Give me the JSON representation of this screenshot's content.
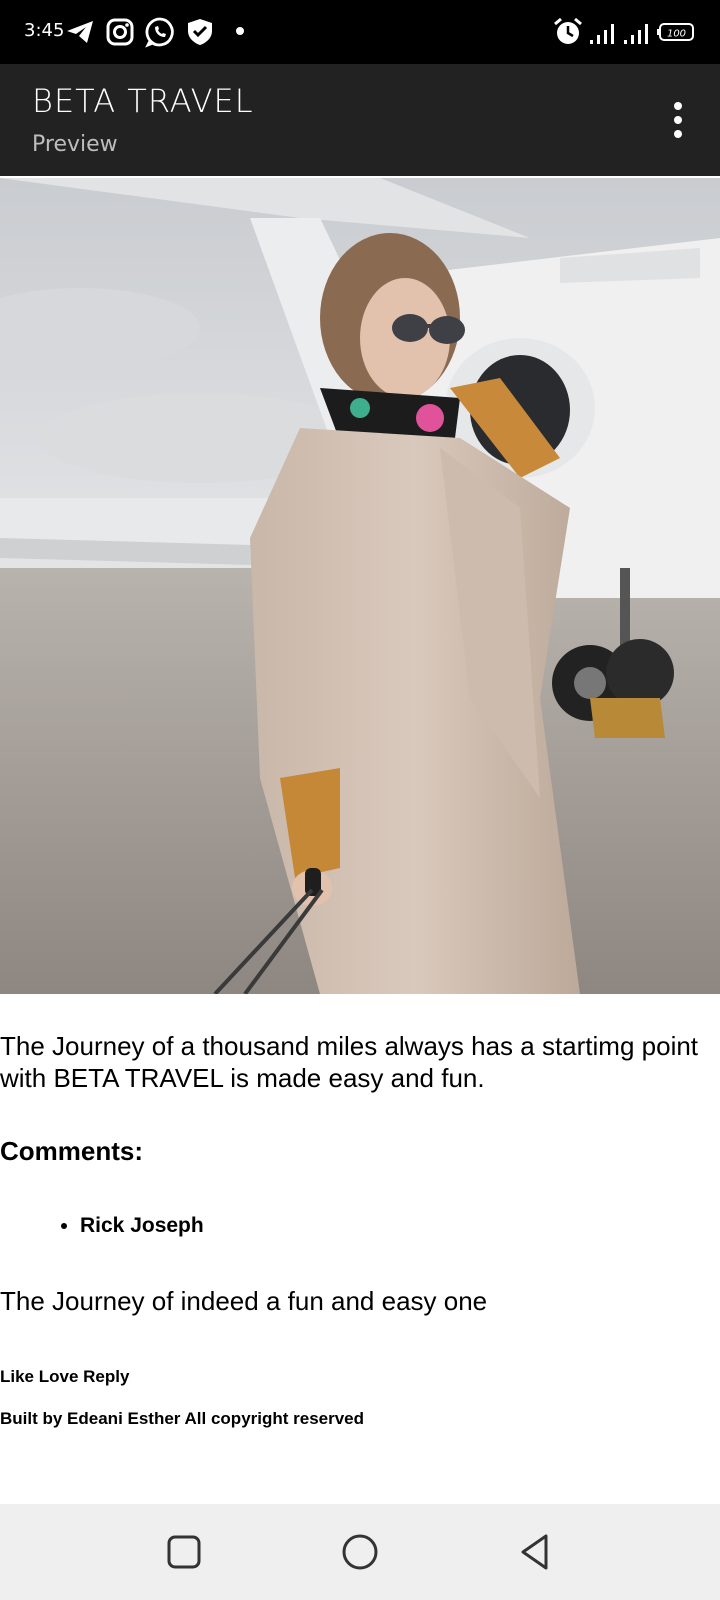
{
  "status_bar": {
    "time": "3:45",
    "battery": "100",
    "icons": [
      "telegram-icon",
      "instagram-icon",
      "whatsapp-icon",
      "shield-icon",
      "alarm-icon",
      "signal-icon",
      "signal-icon",
      "battery-icon"
    ]
  },
  "app_bar": {
    "title": "BETA TRAVEL",
    "subtitle": "Preview",
    "menu_icon": "more-vert-icon"
  },
  "content": {
    "intro": "The Journey of a thousand miles always has a startimg point with BETA TRAVEL is made easy and fun.",
    "comments_heading": "Comments:",
    "commenters": [
      "Rick Joseph"
    ],
    "comment_text": "The Journey of indeed a fun and easy one",
    "actions": "Like Love Reply",
    "footer": "Built by Edeani Esther All copyright reserved"
  },
  "nav_bar": {
    "buttons": [
      "recents-icon",
      "home-icon",
      "back-icon"
    ]
  },
  "colors": {
    "status_bar": "#000000",
    "app_bar": "#222222",
    "nav_bar": "#efefef"
  }
}
